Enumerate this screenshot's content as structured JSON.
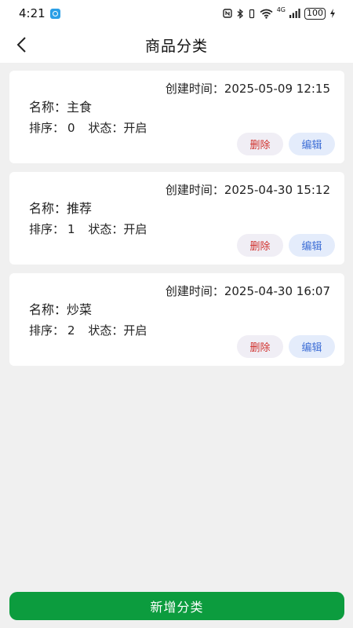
{
  "status_bar": {
    "time": "4:21",
    "network": "4G",
    "battery": "100"
  },
  "header": {
    "title": "商品分类"
  },
  "categories": [
    {
      "created_label": "创建时间：",
      "created_at": "2025-05-09 12:15",
      "name_label": "名称：",
      "name": "主食",
      "sort_label": "排序：",
      "sort": "0",
      "state_label": "状态：",
      "state": "开启",
      "delete_label": "删除",
      "edit_label": "编辑"
    },
    {
      "created_label": "创建时间：",
      "created_at": "2025-04-30 15:12",
      "name_label": "名称：",
      "name": "推荐",
      "sort_label": "排序：",
      "sort": "1",
      "state_label": "状态：",
      "state": "开启",
      "delete_label": "删除",
      "edit_label": "编辑"
    },
    {
      "created_label": "创建时间：",
      "created_at": "2025-04-30 16:07",
      "name_label": "名称：",
      "name": "炒菜",
      "sort_label": "排序：",
      "sort": "2",
      "state_label": "状态：",
      "state": "开启",
      "delete_label": "删除",
      "edit_label": "编辑"
    }
  ],
  "footer": {
    "add_label": "新增分类"
  },
  "colors": {
    "primary": "#0c9c3e",
    "delete_text": "#d0312d",
    "edit_text": "#3f6fd6"
  }
}
